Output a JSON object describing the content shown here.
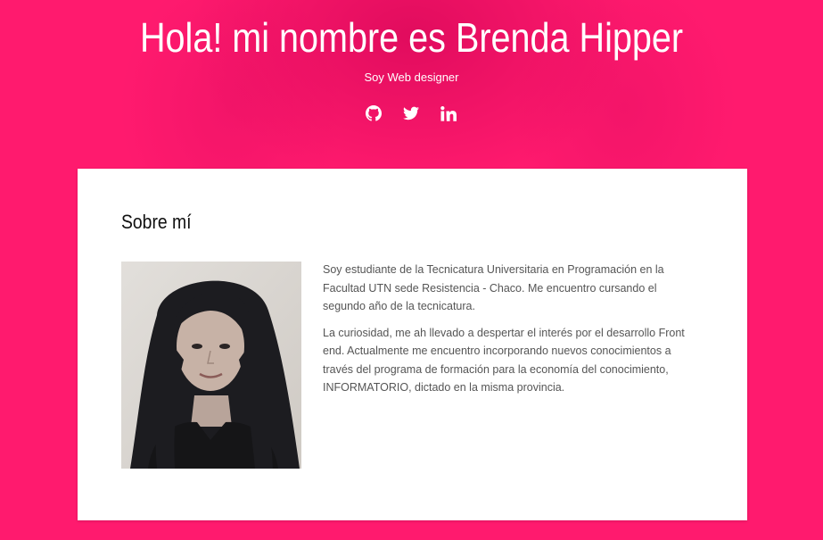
{
  "header": {
    "title": "Hola! mi nombre es Brenda Hipper",
    "subtitle": "Soy Web designer",
    "social": [
      {
        "icon": "github-icon"
      },
      {
        "icon": "twitter-icon"
      },
      {
        "icon": "linkedin-icon"
      }
    ]
  },
  "about": {
    "heading": "Sobre mí",
    "paragraphs": [
      "Soy estudiante de la Tecnicatura Universitaria en Programación en la Facultad UTN sede Resistencia - Chaco. Me encuentro cursando el segundo año de la tecnicatura.",
      "La curiosidad, me ah llevado a despertar el interés por el desarrollo Front end. Actualmente me encuentro incorporando nuevos conocimientos a través del programa de formación para la economía del conocimiento, INFORMATORIO, dictado en la misma provincia."
    ]
  },
  "colors": {
    "background": "#ff1a6e",
    "card": "#ffffff",
    "text": "#555555",
    "heading": "#111111"
  }
}
